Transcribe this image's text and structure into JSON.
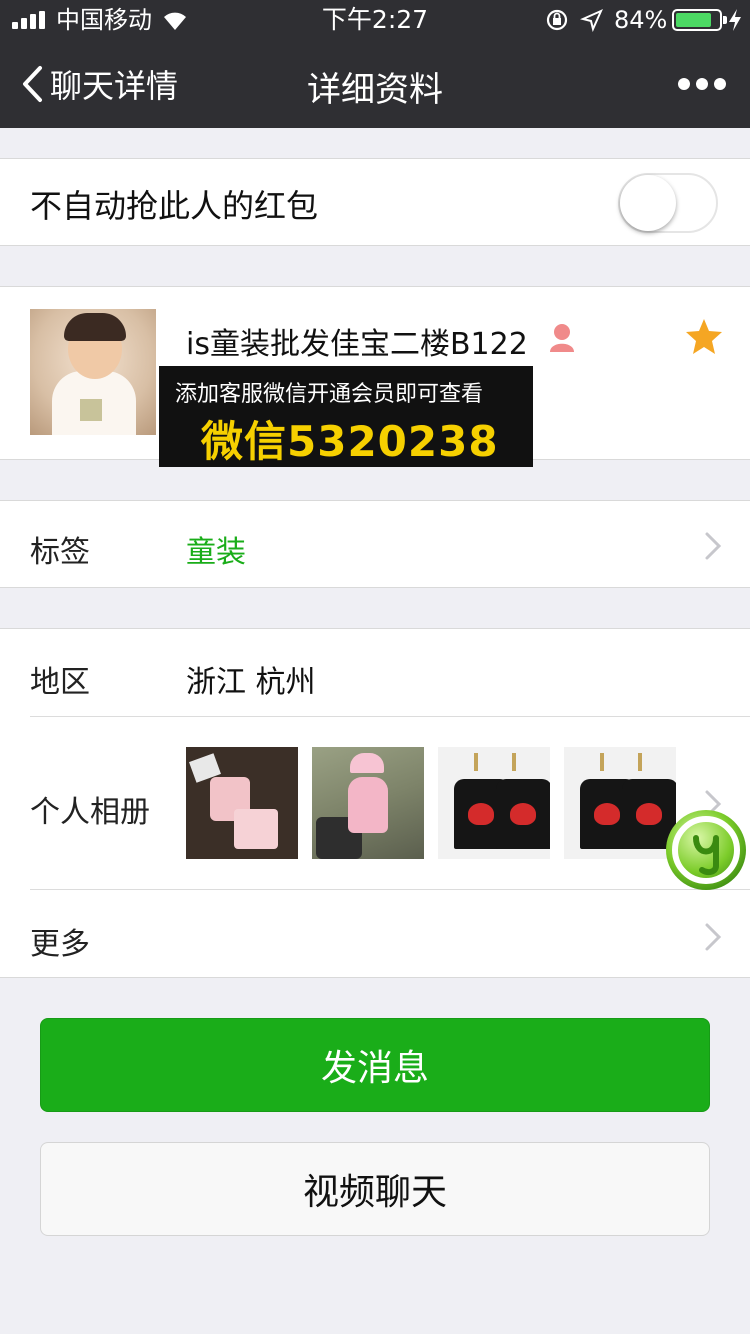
{
  "status_bar": {
    "carrier": "中国移动",
    "time": "下午2:27",
    "battery_pct": "84%",
    "battery_level": 0.84
  },
  "nav": {
    "back_label": "聊天详情",
    "title": "详细资料"
  },
  "red_packet": {
    "label": "不自动抢此人的红包",
    "enabled": false
  },
  "profile": {
    "name": "is童装批发佳宝二楼B122",
    "promo_line1": "添加客服微信开通会员即可查看",
    "promo_line2": "微信5320238"
  },
  "tag_row": {
    "label": "标签",
    "value": "童装"
  },
  "region_row": {
    "label": "地区",
    "value": "浙江 杭州"
  },
  "album_row": {
    "label": "个人相册"
  },
  "more_row": {
    "label": "更多"
  },
  "buttons": {
    "send_message": "发消息",
    "video_chat": "视频聊天"
  },
  "colors": {
    "nav_bg": "#2f2f33",
    "accent_green": "#1aad19",
    "promo_yellow": "#f6d000",
    "star": "#f5a623"
  }
}
